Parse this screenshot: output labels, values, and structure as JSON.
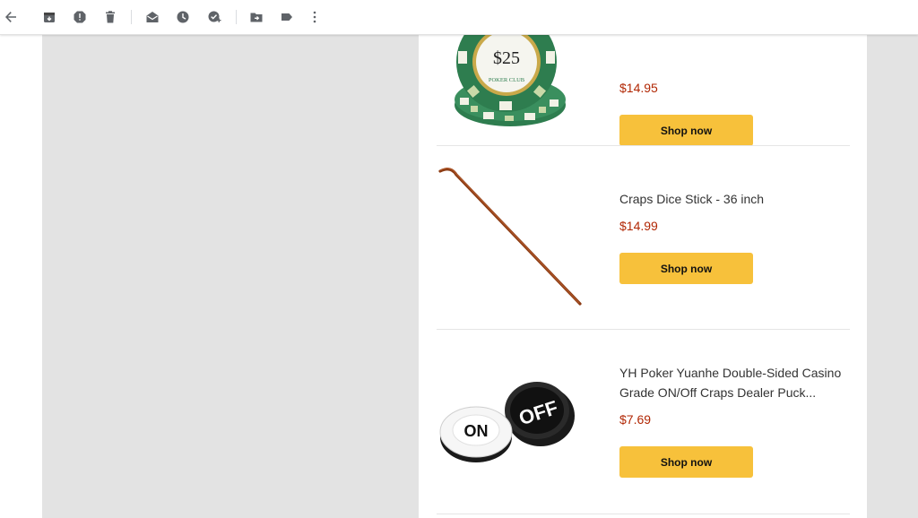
{
  "toolbar": {
    "buttons": [
      {
        "name": "back-arrow-icon"
      },
      {
        "name": "archive-icon"
      },
      {
        "name": "report-spam-icon"
      },
      {
        "name": "delete-icon"
      },
      {
        "name": "mark-unread-icon"
      },
      {
        "name": "snooze-icon"
      },
      {
        "name": "add-to-tasks-icon"
      },
      {
        "name": "move-to-icon"
      },
      {
        "name": "label-icon"
      },
      {
        "name": "more-options-icon"
      }
    ]
  },
  "products": [
    {
      "title": "",
      "price": "$14.95",
      "button": "Shop now",
      "image": "poker-chip-stack"
    },
    {
      "title": "Craps Dice Stick - 36 inch",
      "price": "$14.99",
      "button": "Shop now",
      "image": "craps-dice-stick"
    },
    {
      "title": "YH Poker Yuanhe Double-Sided Casino Grade ON/Off Craps Dealer Puck...",
      "price": "$7.69",
      "button": "Shop now",
      "image": "on-off-puck"
    }
  ],
  "chip_text": {
    "value": "$25",
    "club": "POKER CLUB"
  },
  "puck_text": {
    "on": "ON",
    "off": "OFF"
  },
  "colors": {
    "price": "#b12704",
    "button": "#f7c13b",
    "chip_green": "#2e7d4f"
  }
}
